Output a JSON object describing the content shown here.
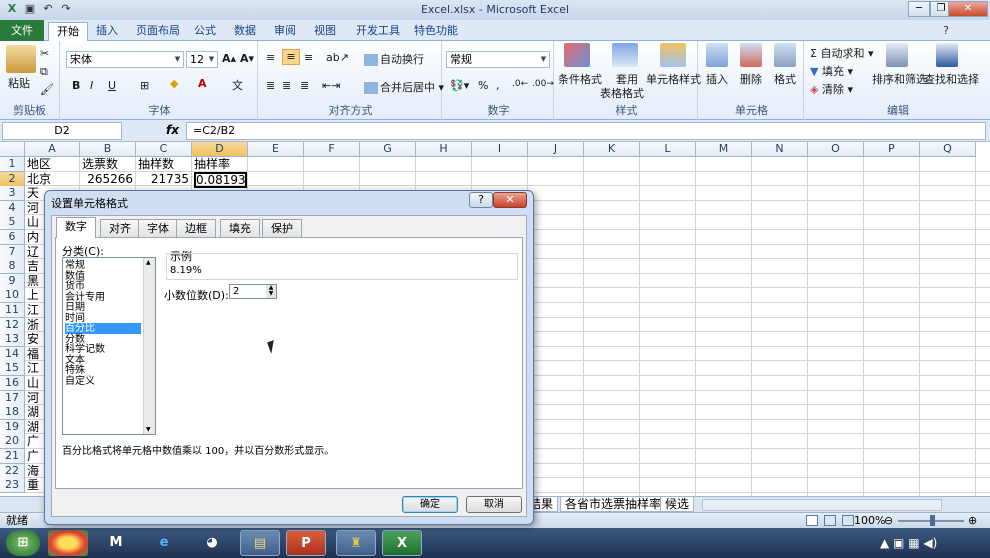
{
  "window": {
    "title": "Excel.xlsx - Microsoft Excel",
    "buttons": {
      "minimize": "─",
      "restore": "❐",
      "close": "✕"
    }
  },
  "ribbon_tabs": [
    "文件",
    "开始",
    "插入",
    "页面布局",
    "公式",
    "数据",
    "审阅",
    "视图",
    "开发工具",
    "特色功能"
  ],
  "ribbon": {
    "clipboard": {
      "label": "剪贴板",
      "paste": "粘贴"
    },
    "font": {
      "label": "字体",
      "name": "宋体",
      "size": "12",
      "bold": "B",
      "italic": "I",
      "underline": "U"
    },
    "alignment": {
      "label": "对齐方式",
      "wrap": "自动换行",
      "merge": "合并后居中"
    },
    "number": {
      "label": "数字",
      "format": "常规",
      "percent": "%",
      "comma": ","
    },
    "styles": {
      "label": "样式",
      "conditional": "条件格式",
      "table_line1": "套用",
      "table_line2": "表格格式",
      "cell_styles": "单元格样式"
    },
    "cells": {
      "label": "单元格",
      "insert": "插入",
      "delete": "删除",
      "format": "格式"
    },
    "editing": {
      "label": "编辑",
      "autosum": "自动求和",
      "fill": "填充",
      "clear": "清除",
      "sort": "排序和筛选",
      "find": "查找和选择"
    }
  },
  "formula_bar": {
    "name_box": "D2",
    "fx": "fx",
    "formula": "=C2/B2"
  },
  "sheet": {
    "columns": [
      "A",
      "B",
      "C",
      "D",
      "E",
      "F",
      "G",
      "H",
      "I",
      "J",
      "K",
      "L",
      "M",
      "N",
      "O",
      "P",
      "Q"
    ],
    "rows": [
      "1",
      "2",
      "3",
      "4",
      "5",
      "6",
      "7",
      "8",
      "9",
      "10",
      "11",
      "12",
      "13",
      "14",
      "15",
      "16",
      "17",
      "18",
      "19",
      "20",
      "21",
      "22",
      "23"
    ],
    "row1": [
      "地区",
      "选票数",
      "抽样数",
      "抽样率"
    ],
    "row2": [
      "北京",
      "265266",
      "21735",
      "0.081937"
    ],
    "col_a_partial": [
      "天",
      "河",
      "山",
      "内",
      "辽",
      "吉",
      "黑",
      "上",
      "江",
      "浙",
      "安",
      "福",
      "江",
      "山",
      "河",
      "湖",
      "湖",
      "广",
      "广",
      "海",
      "重"
    ]
  },
  "sheet_tabs": [
    "结果",
    "各省市选票抽样率",
    "候选"
  ],
  "status": {
    "ready": "就绪",
    "zoom": "100%"
  },
  "dialog": {
    "title": "设置单元格格式",
    "help": "?",
    "close": "✕",
    "tabs": [
      "数字",
      "对齐",
      "字体",
      "边框",
      "填充",
      "保护"
    ],
    "category_label": "分类(C):",
    "categories": [
      "常规",
      "数值",
      "货币",
      "会计专用",
      "日期",
      "时间",
      "百分比",
      "分数",
      "科学记数",
      "文本",
      "特殊",
      "自定义"
    ],
    "selected_category": "百分比",
    "sample_label": "示例",
    "sample_value": "8.19%",
    "decimal_label": "小数位数(D):",
    "decimal_value": "2",
    "description": "百分比格式将单元格中数值乘以 100，并以百分数形式显示。",
    "ok": "确定",
    "cancel": "取消"
  },
  "colors": {
    "accent": "#2a7a3c",
    "selection": "#3399ff",
    "header_selected": "#f1c15f"
  }
}
